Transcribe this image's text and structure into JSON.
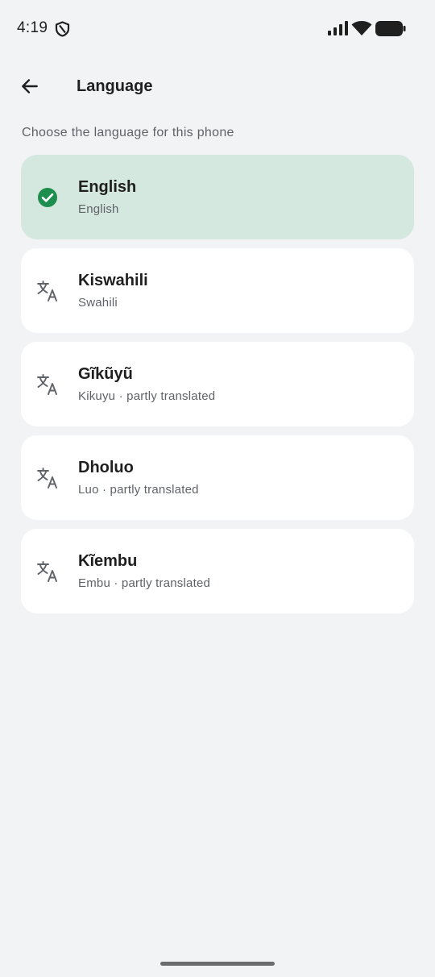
{
  "status_bar": {
    "time": "4:19",
    "icons": [
      "shield-icon",
      "signal-icon",
      "wifi-icon",
      "battery-icon"
    ]
  },
  "header": {
    "back_icon": "arrow-back-icon",
    "title": "Language"
  },
  "subtitle": "Choose the language for this phone",
  "languages": [
    {
      "name": "English",
      "sub": "English",
      "selected": true,
      "icon": "check-circle-icon"
    },
    {
      "name": "Kiswahili",
      "sub": "Swahili",
      "selected": false,
      "icon": "translate-icon"
    },
    {
      "name": "Gĩkũyũ",
      "sub": "Kikuyu · partly translated",
      "selected": false,
      "icon": "translate-icon"
    },
    {
      "name": "Dholuo",
      "sub": "Luo · partly translated",
      "selected": false,
      "icon": "translate-icon"
    },
    {
      "name": "Kĩembu",
      "sub": "Embu · partly translated",
      "selected": false,
      "icon": "translate-icon"
    }
  ],
  "colors": {
    "background": "#f1f3f4",
    "selected_card": "#d5e8df",
    "check_green": "#1e8e4e",
    "icon_gray": "#5f6368"
  }
}
